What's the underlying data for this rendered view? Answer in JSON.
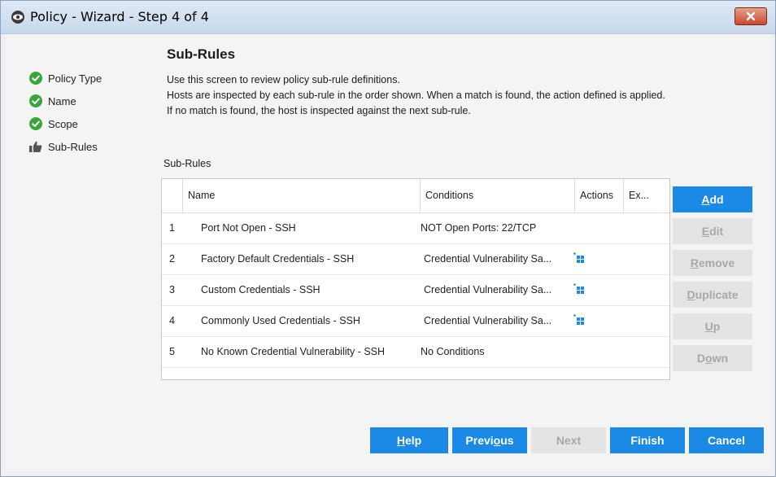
{
  "window": {
    "title": "Policy - Wizard - Step 4 of 4",
    "close_label": "x"
  },
  "steps": [
    {
      "label": "Policy Type",
      "state": "complete",
      "icon": "check-circle-icon"
    },
    {
      "label": "Name",
      "state": "complete",
      "icon": "check-circle-icon"
    },
    {
      "label": "Scope",
      "state": "complete",
      "icon": "check-circle-icon"
    },
    {
      "label": "Sub-Rules",
      "state": "current",
      "icon": "thumbs-up-icon"
    }
  ],
  "main": {
    "heading": "Sub-Rules",
    "description": [
      "Use this screen to review policy sub-rule definitions.",
      "Hosts are inspected by each sub-rule in the order shown. When a match is found, the action defined is applied.",
      "If no match is found, the host is inspected against the next sub-rule."
    ],
    "table_label": "Sub-Rules"
  },
  "table": {
    "columns": [
      "Name",
      "Conditions",
      "Actions",
      "Ex..."
    ],
    "rows": [
      {
        "num": "1",
        "name": "Port Not Open - SSH",
        "conditions": "NOT  Open Ports: 22/TCP",
        "has_action": false
      },
      {
        "num": "2",
        "name": "Factory Default Credentials - SSH",
        "conditions": "Credential Vulnerability Sa...",
        "has_action": true
      },
      {
        "num": "3",
        "name": "Custom Credentials - SSH",
        "conditions": "Credential Vulnerability Sa...",
        "has_action": true
      },
      {
        "num": "4",
        "name": "Commonly Used Credentials - SSH",
        "conditions": "Credential Vulnerability Sa...",
        "has_action": true
      },
      {
        "num": "5",
        "name": "No Known Credential Vulnerability - SSH",
        "conditions": "No Conditions",
        "has_action": false
      }
    ]
  },
  "side_buttons": {
    "add": {
      "pre": "",
      "u": "A",
      "post": "dd"
    },
    "edit": {
      "pre": "",
      "u": "E",
      "post": "dit"
    },
    "remove": {
      "pre": "",
      "u": "R",
      "post": "emove"
    },
    "duplicate": {
      "pre": "",
      "u": "D",
      "post": "uplicate"
    },
    "up": {
      "pre": "",
      "u": "U",
      "post": "p"
    },
    "down": {
      "pre": "D",
      "u": "o",
      "post": "wn"
    }
  },
  "footer": {
    "help": {
      "pre": "",
      "u": "H",
      "post": "elp"
    },
    "previous": {
      "pre": "Previ",
      "u": "o",
      "post": "us"
    },
    "next": "Next",
    "finish": "Finish",
    "cancel": "Cancel"
  },
  "colors": {
    "primary": "#1b8ae6",
    "check": "#3aa63a",
    "disabled_bg": "#e4e4e4",
    "disabled_text": "#a8a8a8"
  }
}
